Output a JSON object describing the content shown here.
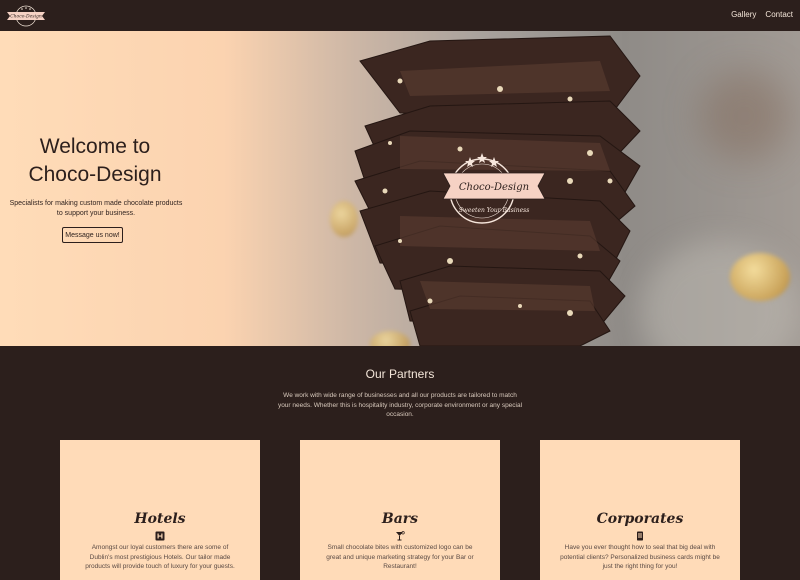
{
  "nav": {
    "logo_text": "Choco-Design",
    "links": [
      "Gallery",
      "Contact"
    ]
  },
  "hero": {
    "title_line1": "Welcome to",
    "title_line2": "Choco-Design",
    "subtitle": "Specialists for making custom made chocolate products to support your business.",
    "button": "Message us now!",
    "badge_title": "Choco-Design",
    "badge_tagline": "Sweeten Your Business"
  },
  "partners": {
    "title": "Our Partners",
    "text": "We work with wide range of businesses and all our products are tailored to match your needs. Whether this is hospitality industry, corporate environment or any special occasion.",
    "cards": [
      {
        "title": "Hotels",
        "icon": "hotel-icon",
        "text": "Amongst our loyal customers there are some of Dublin's most prestigious Hotels. Our tailor made products will provide touch of luxury for your guests."
      },
      {
        "title": "Bars",
        "icon": "cocktail-icon",
        "text": "Small chocolate bites with customized logo can be great and unique marketing strategy for your Bar or Restaurant!"
      },
      {
        "title": "Corporates",
        "icon": "briefcase-icon",
        "text": "Have you ever thought how to seal that big deal with potential clients? Personalized business cards might be just the right thing for you!"
      }
    ]
  },
  "colors": {
    "dark_brown": "#2c1f1c",
    "peach": "#ffdbb8",
    "badge_pink": "#f6d2c4"
  }
}
